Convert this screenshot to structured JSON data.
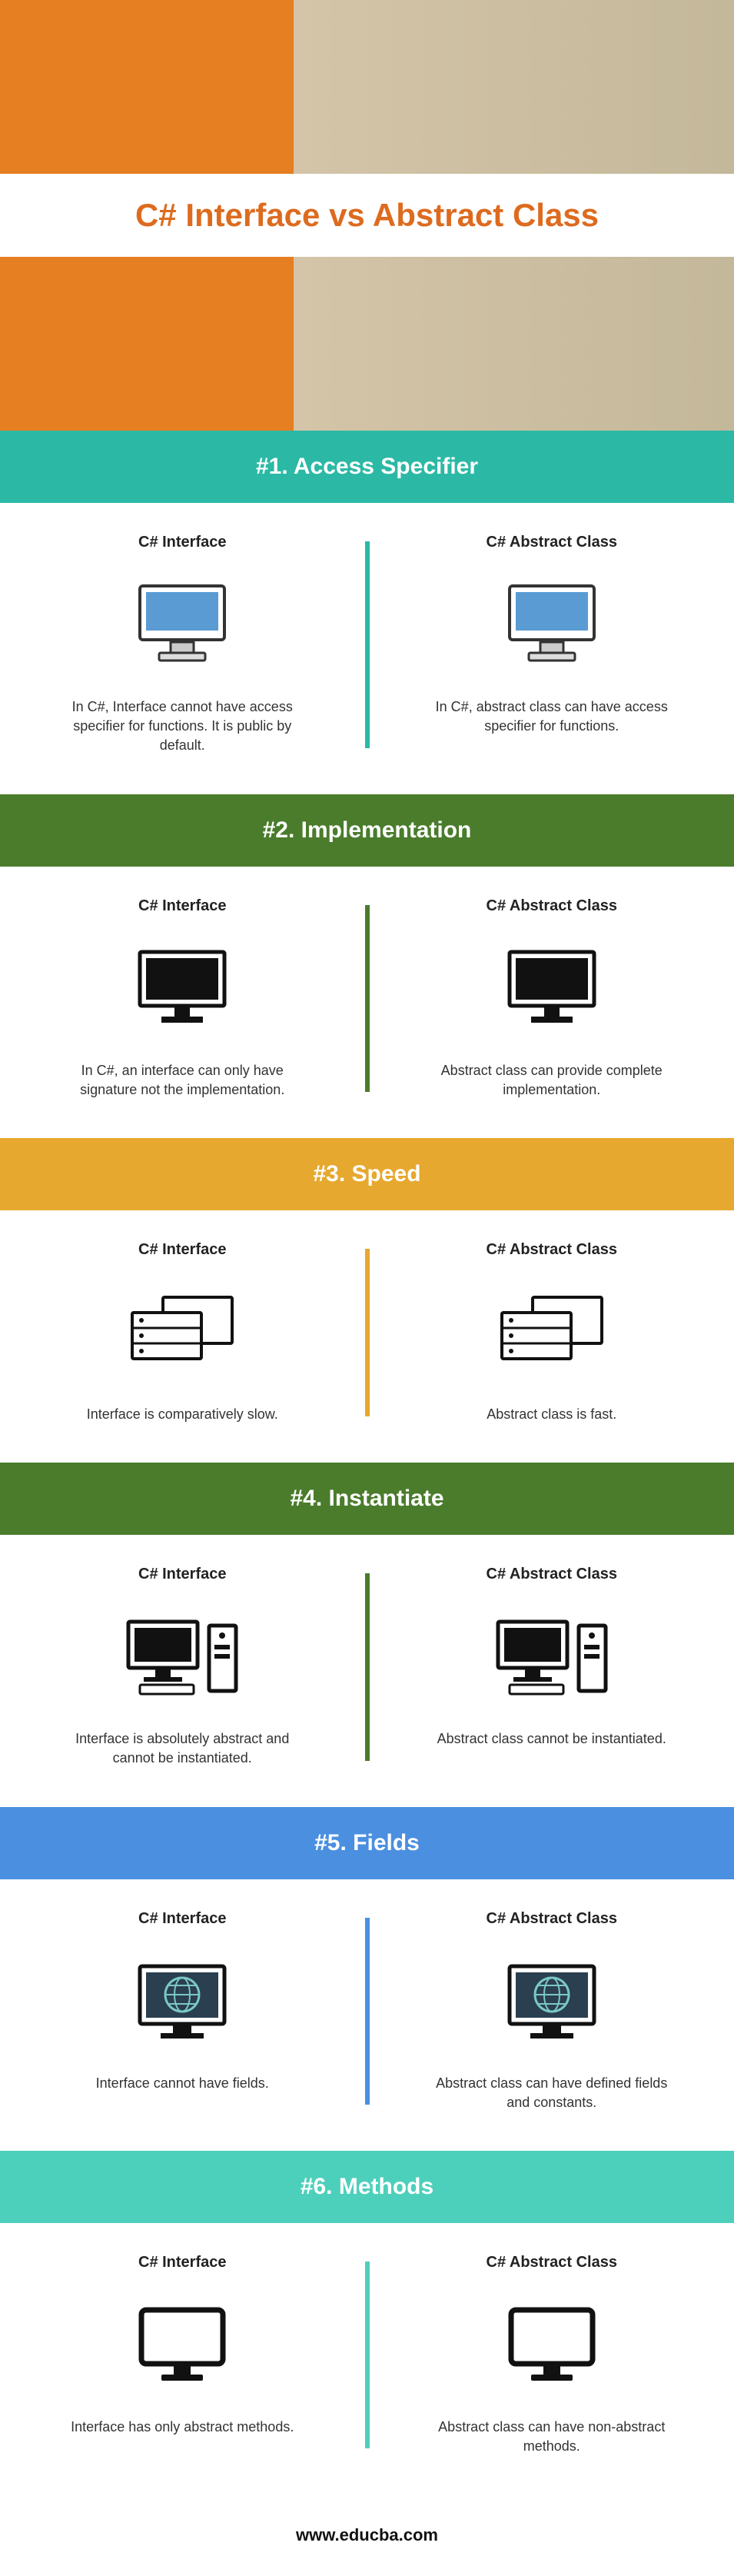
{
  "hero": {
    "title": "C# Interface vs Abstract Class"
  },
  "columns": {
    "left_title": "C# Interface",
    "right_title": "C# Abstract Class"
  },
  "sections": [
    {
      "header": "#1. Access Specifier",
      "header_class": "bg-teal",
      "divider_color": "#2bb9a5",
      "icon": "imac",
      "left_desc": "In C#, Interface cannot have access specifier for functions. It is public by default.",
      "right_desc": "In C#, abstract class can have access specifier for functions."
    },
    {
      "header": "#2. Implementation",
      "header_class": "bg-green",
      "divider_color": "#4a7c2c",
      "icon": "monitor",
      "left_desc": "In C#, an interface can only have signature not the implementation.",
      "right_desc": "Abstract class can provide complete implementation."
    },
    {
      "header": "#3. Speed",
      "header_class": "bg-orange",
      "divider_color": "#e6a82e",
      "icon": "server",
      "left_desc": "Interface is comparatively slow.",
      "right_desc": "Abstract class is fast."
    },
    {
      "header": "#4. Instantiate",
      "header_class": "bg-green",
      "divider_color": "#4a7c2c",
      "icon": "desktop",
      "left_desc": "Interface is absolutely abstract and cannot be instantiated.",
      "right_desc": "Abstract class cannot be instantiated."
    },
    {
      "header": "#5. Fields",
      "header_class": "bg-blue",
      "divider_color": "#4a8fe0",
      "icon": "globe",
      "left_desc": "Interface cannot have fields.",
      "right_desc": "Abstract class can have defined fields and constants."
    },
    {
      "header": "#6. Methods",
      "header_class": "bg-mint",
      "divider_color": "#4dd0bb",
      "icon": "screen",
      "left_desc": "Interface has only abstract methods.",
      "right_desc": "Abstract class can have non-abstract methods."
    }
  ],
  "footer": {
    "url": "www.educba.com"
  }
}
